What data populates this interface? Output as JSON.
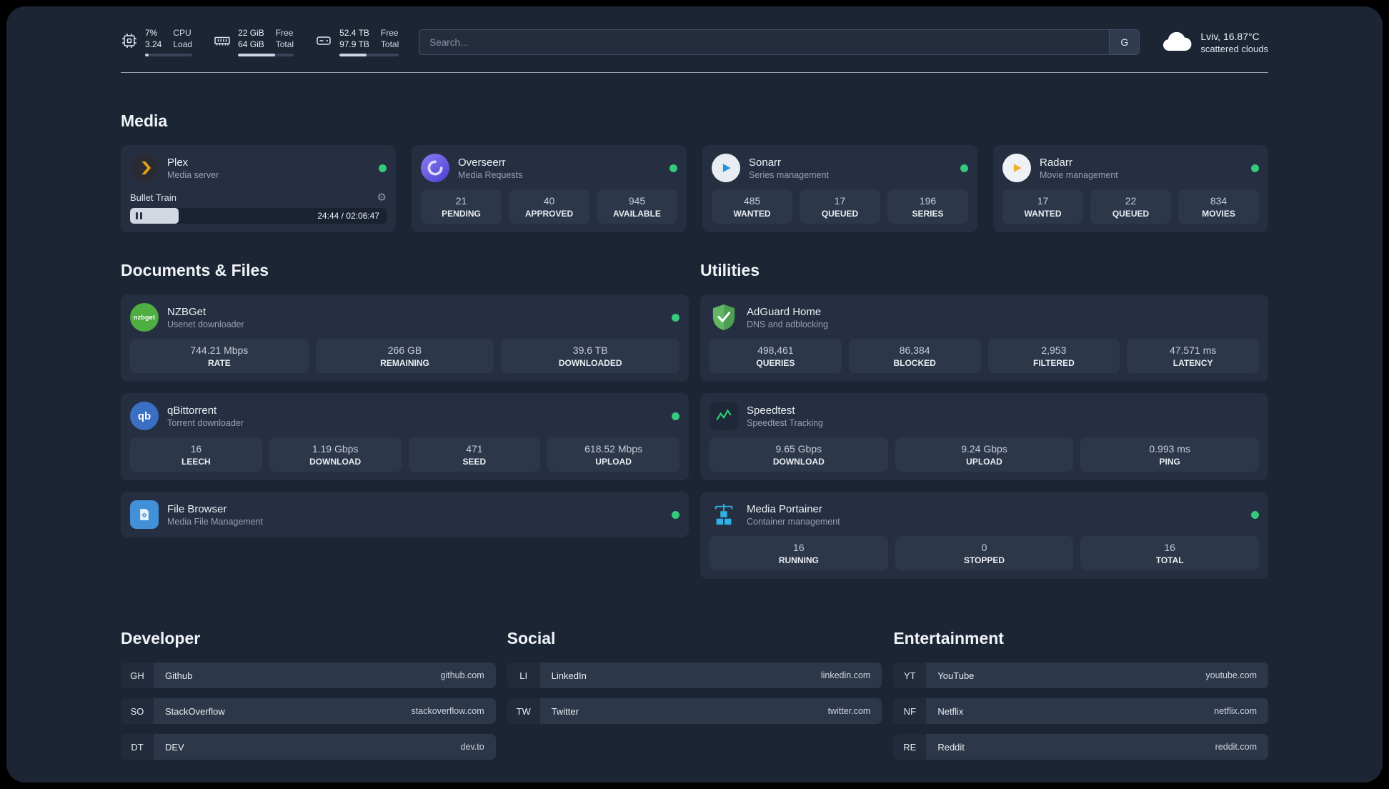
{
  "colors": {
    "status_online": "#35c97d",
    "plex_orange": "#e5a00d",
    "radarr_yellow": "#f1b12d",
    "sonarr_blue": "#2596cf",
    "adguard_green": "#63b663",
    "portainer_blue": "#2fb1e3",
    "speedtest_green": "#2fcf7a"
  },
  "icons": {
    "gear_glyph": "⚙"
  },
  "topbar": {
    "cpu": {
      "percent": "7%",
      "load": "3.24",
      "label_top": "CPU",
      "label_bottom": "Load",
      "bar_percent": 7
    },
    "ram": {
      "free": "22 GiB",
      "total": "64 GiB",
      "free_label": "Free",
      "total_label": "Total",
      "bar_percent": 66
    },
    "disk": {
      "free": "52.4 TB",
      "total": "97.9 TB",
      "free_label": "Free",
      "total_label": "Total",
      "bar_percent": 46
    },
    "search": {
      "placeholder": "Search...",
      "engine_label": "G"
    },
    "weather": {
      "location": "Lviv, 16.87°C",
      "condition": "scattered clouds"
    }
  },
  "media": {
    "title": "Media",
    "plex": {
      "name": "Plex",
      "subtitle": "Media server",
      "now_playing": "Bullet Train",
      "time": "24:44 / 02:06:47",
      "progress_percent": 19
    },
    "overseerr": {
      "name": "Overseerr",
      "subtitle": "Media Requests",
      "stats": [
        {
          "value": "21",
          "label": "PENDING"
        },
        {
          "value": "40",
          "label": "APPROVED"
        },
        {
          "value": "945",
          "label": "AVAILABLE"
        }
      ]
    },
    "sonarr": {
      "name": "Sonarr",
      "subtitle": "Series management",
      "stats": [
        {
          "value": "485",
          "label": "WANTED"
        },
        {
          "value": "17",
          "label": "QUEUED"
        },
        {
          "value": "196",
          "label": "SERIES"
        }
      ]
    },
    "radarr": {
      "name": "Radarr",
      "subtitle": "Movie management",
      "stats": [
        {
          "value": "17",
          "label": "WANTED"
        },
        {
          "value": "22",
          "label": "QUEUED"
        },
        {
          "value": "834",
          "label": "MOVIES"
        }
      ]
    }
  },
  "documents": {
    "title": "Documents & Files",
    "nzbget": {
      "name": "NZBGet",
      "subtitle": "Usenet downloader",
      "stats": [
        {
          "value": "744.21 Mbps",
          "label": "RATE"
        },
        {
          "value": "266 GB",
          "label": "REMAINING"
        },
        {
          "value": "39.6 TB",
          "label": "DOWNLOADED"
        }
      ]
    },
    "qbittorrent": {
      "name": "qBittorrent",
      "subtitle": "Torrent downloader",
      "stats": [
        {
          "value": "16",
          "label": "LEECH"
        },
        {
          "value": "1.19 Gbps",
          "label": "DOWNLOAD"
        },
        {
          "value": "471",
          "label": "SEED"
        },
        {
          "value": "618.52 Mbps",
          "label": "UPLOAD"
        }
      ]
    },
    "filebrowser": {
      "name": "File Browser",
      "subtitle": "Media File Management"
    }
  },
  "utilities": {
    "title": "Utilities",
    "adguard": {
      "name": "AdGuard Home",
      "subtitle": "DNS and adblocking",
      "stats": [
        {
          "value": "498,461",
          "label": "QUERIES"
        },
        {
          "value": "86,384",
          "label": "BLOCKED"
        },
        {
          "value": "2,953",
          "label": "FILTERED"
        },
        {
          "value": "47.571 ms",
          "label": "LATENCY"
        }
      ]
    },
    "speedtest": {
      "name": "Speedtest",
      "subtitle": "Speedtest Tracking",
      "stats": [
        {
          "value": "9.65 Gbps",
          "label": "DOWNLOAD"
        },
        {
          "value": "9.24 Gbps",
          "label": "UPLOAD"
        },
        {
          "value": "0.993 ms",
          "label": "PING"
        }
      ]
    },
    "portainer": {
      "name": "Media Portainer",
      "subtitle": "Container management",
      "stats": [
        {
          "value": "16",
          "label": "RUNNING"
        },
        {
          "value": "0",
          "label": "STOPPED"
        },
        {
          "value": "16",
          "label": "TOTAL"
        }
      ]
    }
  },
  "bookmarks": {
    "developer": {
      "title": "Developer",
      "items": [
        {
          "abbr": "GH",
          "name": "Github",
          "url": "github.com"
        },
        {
          "abbr": "SO",
          "name": "StackOverflow",
          "url": "stackoverflow.com"
        },
        {
          "abbr": "DT",
          "name": "DEV",
          "url": "dev.to"
        }
      ]
    },
    "social": {
      "title": "Social",
      "items": [
        {
          "abbr": "LI",
          "name": "LinkedIn",
          "url": "linkedin.com"
        },
        {
          "abbr": "TW",
          "name": "Twitter",
          "url": "twitter.com"
        }
      ]
    },
    "entertainment": {
      "title": "Entertainment",
      "items": [
        {
          "abbr": "YT",
          "name": "YouTube",
          "url": "youtube.com"
        },
        {
          "abbr": "NF",
          "name": "Netflix",
          "url": "netflix.com"
        },
        {
          "abbr": "RE",
          "name": "Reddit",
          "url": "reddit.com"
        }
      ]
    }
  }
}
